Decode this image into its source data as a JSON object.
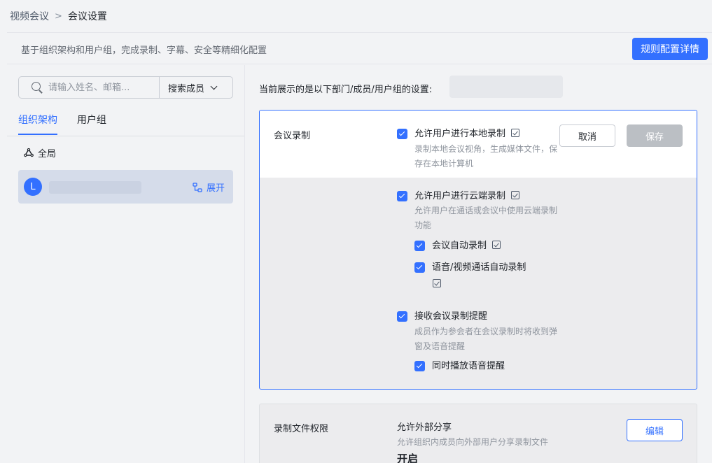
{
  "breadcrumb": {
    "root": "视频会议",
    "separator": ">",
    "current": "会议设置"
  },
  "header": {
    "description": "基于组织架构和用户组，完成录制、字幕、安全等精细化配置",
    "rules_button": "规则配置详情"
  },
  "sidebar": {
    "search": {
      "placeholder": "请输入姓名、邮箱...",
      "scope": "搜索成员"
    },
    "tabs": [
      {
        "label": "组织架构",
        "active": true
      },
      {
        "label": "用户组",
        "active": false
      }
    ],
    "global_label": "全局",
    "org": {
      "avatar_letter": "L",
      "expand_label": "展开"
    }
  },
  "main": {
    "showing_label": "当前展示的是以下部门/成员/用户组的设置:",
    "recording": {
      "title": "会议录制",
      "cancel_label": "取消",
      "save_label": "保存",
      "options": [
        {
          "label": "允许用户进行本地录制",
          "desc": "录制本地会议视角，生成媒体文件，保存在本地计算机",
          "checked": true
        },
        {
          "label": "允许用户进行云端录制",
          "desc": "允许用户在通话或会议中使用云端录制功能",
          "checked": true
        },
        {
          "label": "会议自动录制",
          "checked": true
        },
        {
          "label": "语音/视频通话自动录制",
          "checked": true
        },
        {
          "label": "接收会议录制提醒",
          "desc": "成员作为参会者在会议录制时将收到弹窗及语音提醒",
          "checked": true
        },
        {
          "label": "同时播放语音提醒",
          "checked": true
        }
      ]
    },
    "file_permission": {
      "title": "录制文件权限",
      "name": "允许外部分享",
      "desc": "允许组织内成员向外部用户分享录制文件",
      "value": "开启",
      "edit_label": "编辑"
    }
  },
  "colors": {
    "primary": "#3370ff",
    "disabled": "#bbbfc4"
  }
}
